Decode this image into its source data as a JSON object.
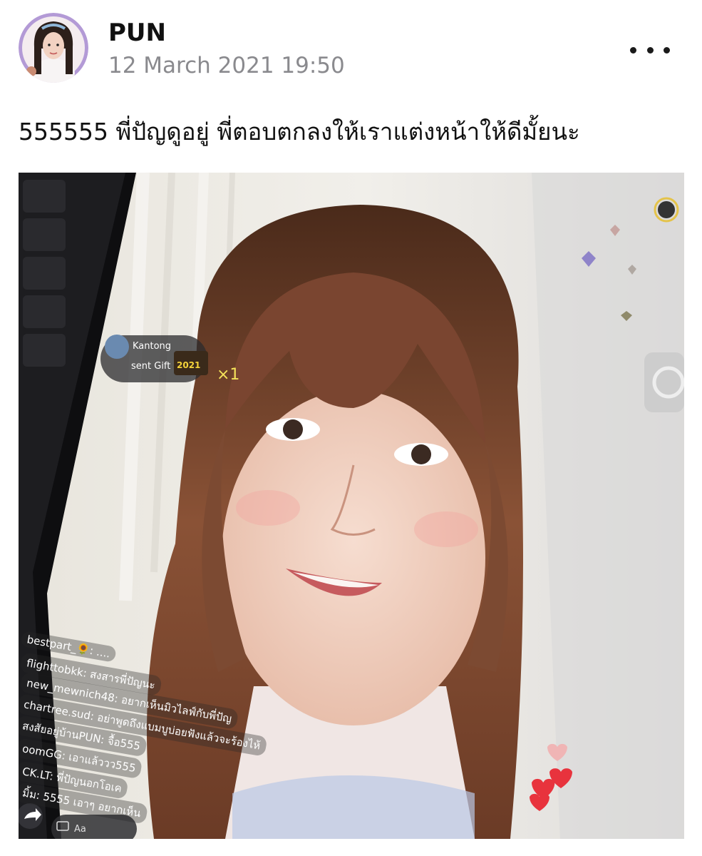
{
  "post": {
    "author": "PUN",
    "timestamp": "12 March 2021 19:50",
    "text": "555555 พี่ปัญดูอยู่ พี่ตอบตกลงให้เราแต่งหน้าให้ดีมั้ยนะ"
  },
  "gift": {
    "sender": "Kantong",
    "action": "sent Gift",
    "badge": "2021",
    "multiplier": "×1"
  },
  "chat": [
    "bestpart_🌻: ....",
    "flighttobkk: สงสารพี่ปัญนะ",
    "new_mewnich48: อยากเห็นมิวไลฟ์กับพี่ปัญ",
    "chartree.sud: อย่าพูดถึงแบมบูบ่อยฟังแล้วจะร้องไห้",
    "สงสัยอยู่บ้านPUN: จื้อ555",
    "oomGG: เอาแล้ววว555",
    "CK.LT: พี่ปัญนอกโอเค",
    "มิ้ม: 5555 เอาๆ อยากเห็น"
  ],
  "composer": {
    "placeholder": "Aa"
  },
  "colors": {
    "text": "#111111",
    "muted": "#8a8a8e",
    "heart": "#e8333d"
  }
}
